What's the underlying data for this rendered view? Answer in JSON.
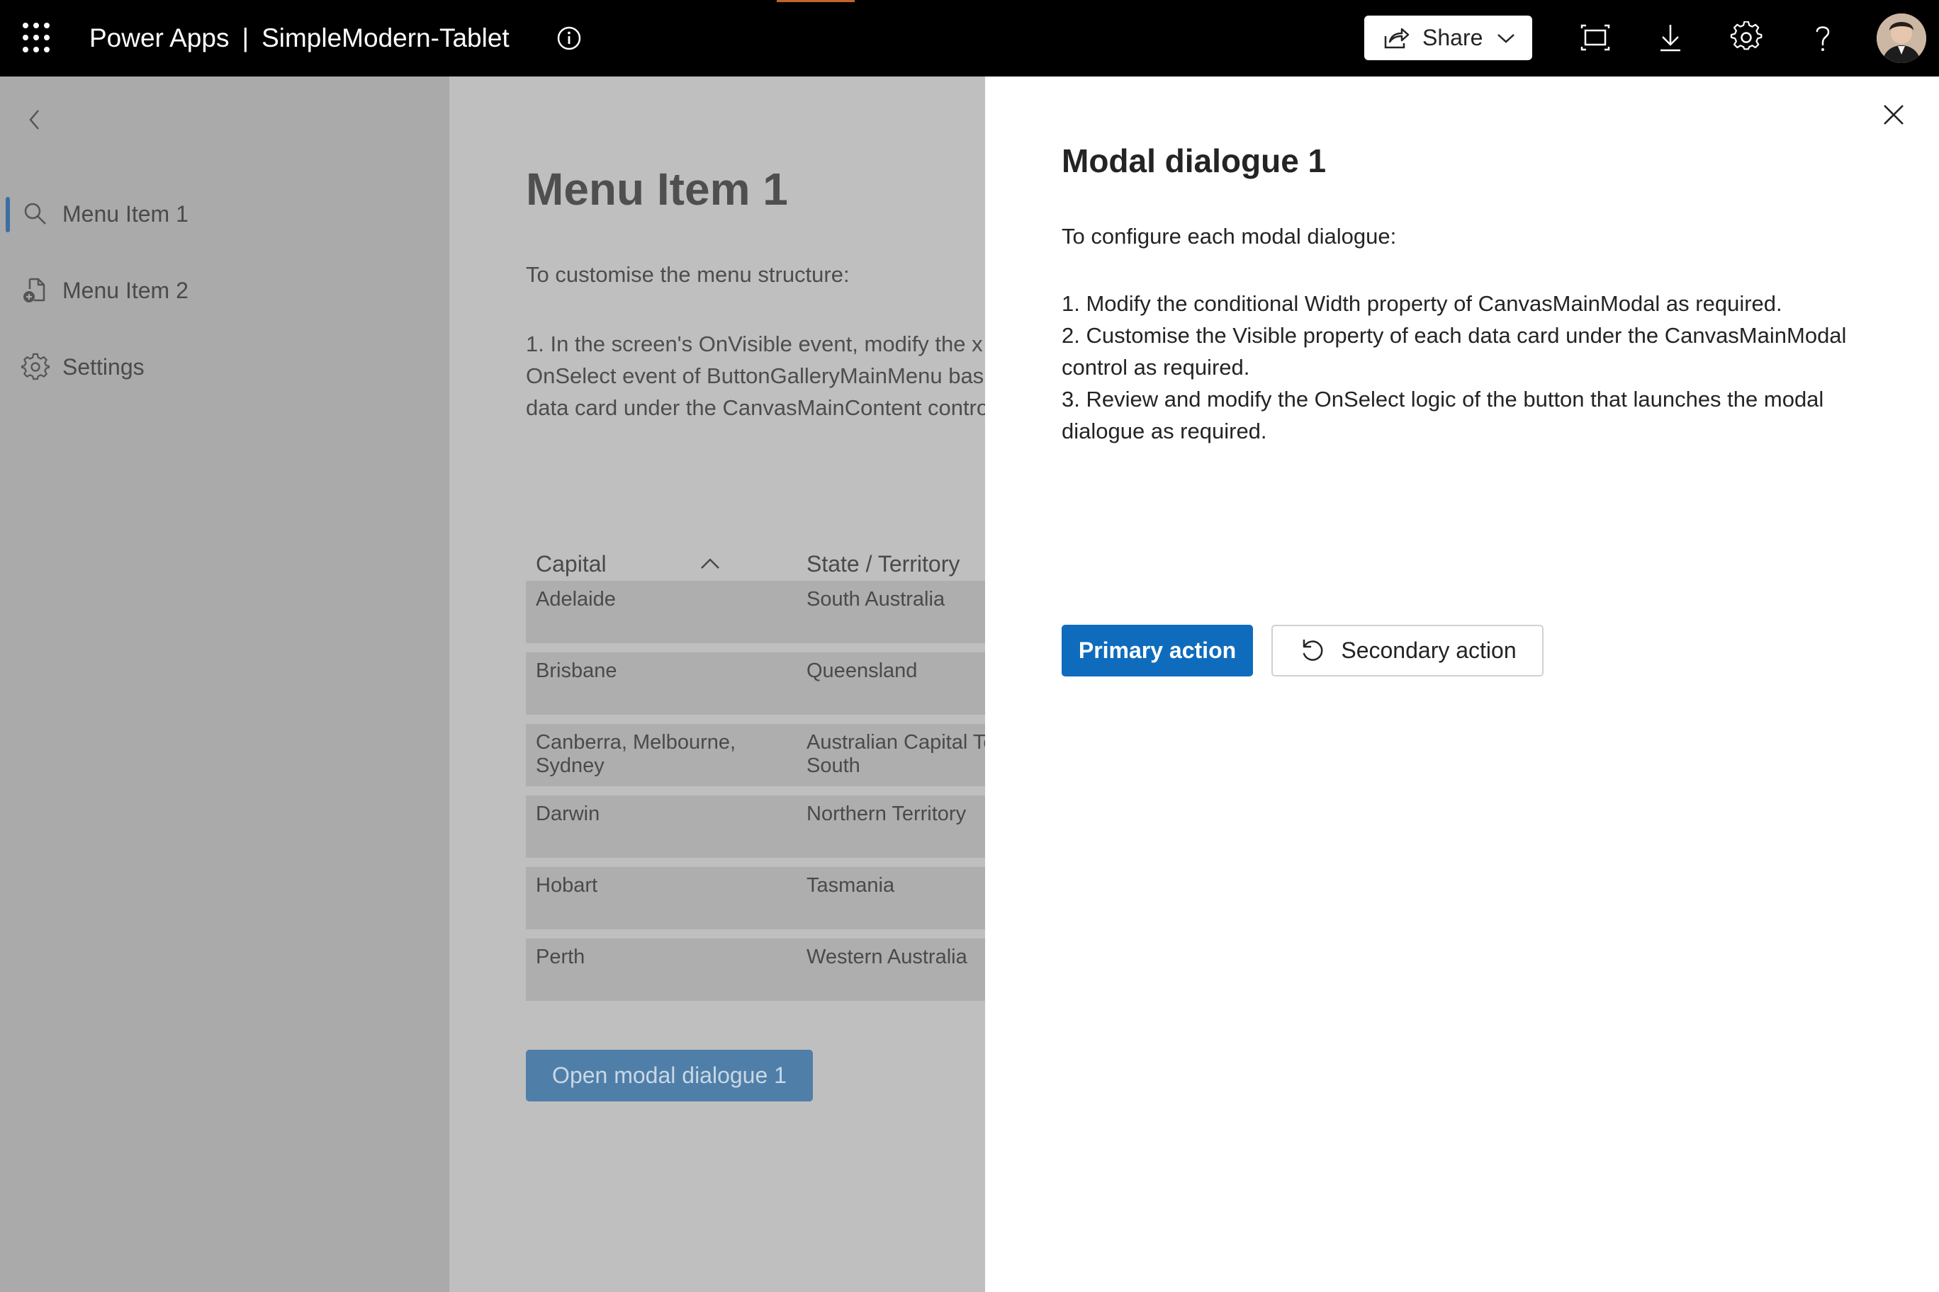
{
  "topbar": {
    "app_name": "Power Apps",
    "separator": "|",
    "screen_name": "SimpleModern-Tablet",
    "share_label": "Share",
    "icons": [
      "app-launcher-icon",
      "info-icon",
      "share-icon",
      "chevron-down-icon",
      "fit-to-window-icon",
      "download-icon",
      "settings-icon",
      "help-icon",
      "avatar"
    ]
  },
  "nav": {
    "items": [
      {
        "label": "Menu Item 1",
        "icon": "search-icon",
        "selected": true
      },
      {
        "label": "Menu Item 2",
        "icon": "document-add-icon",
        "selected": false
      },
      {
        "label": "Settings",
        "icon": "gear-icon",
        "selected": false
      }
    ]
  },
  "main": {
    "title": "Menu Item 1",
    "intro": "To customise the menu structure:",
    "step_lines": [
      "1. In the screen's OnVisible event, modify the x",
      "OnSelect event of ButtonGalleryMainMenu bas",
      "data card under the CanvasMainContent contro"
    ],
    "table": {
      "headers": [
        "Capital",
        "State / Territory"
      ],
      "rows": [
        [
          "Adelaide",
          "South Australia"
        ],
        [
          "Brisbane",
          "Queensland"
        ],
        [
          "Canberra, Melbourne, Sydney",
          "Australian Capital Territory, New South"
        ],
        [
          "Darwin",
          "Northern Territory"
        ],
        [
          "Hobart",
          "Tasmania"
        ],
        [
          "Perth",
          "Western Australia"
        ]
      ]
    },
    "open_modal_label": "Open modal dialogue 1"
  },
  "modal": {
    "title": "Modal dialogue 1",
    "intro": "To configure each modal dialogue:",
    "step_lines": [
      "1. Modify the conditional Width property of CanvasMainModal as required.",
      "2. Customise the Visible property of each data card under the CanvasMainModal",
      "control as required.",
      "3. Review and modify the OnSelect logic of the button that launches the modal",
      "dialogue as required."
    ],
    "primary_label": "Primary action",
    "secondary_label": "Secondary action"
  },
  "colors": {
    "topbar": "#000000",
    "primary_button": "#0f6cbd",
    "overlay_nav": "#aaaaaa",
    "overlay_main": "#bfbfbf",
    "accent_bar": "#3d6ea3"
  }
}
